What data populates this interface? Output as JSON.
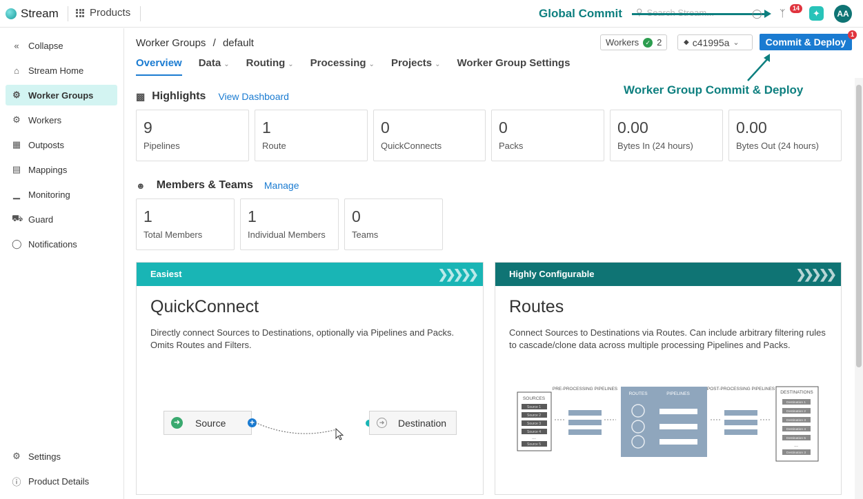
{
  "topbar": {
    "app_name": "Stream",
    "products_label": "Products",
    "global_commit_annotation": "Global Commit",
    "search_placeholder": "Search Stream...",
    "changes_badge": "14"
  },
  "user": {
    "initials": "AA"
  },
  "sidebar": {
    "items": [
      {
        "label": "Collapse"
      },
      {
        "label": "Stream Home"
      },
      {
        "label": "Worker Groups"
      },
      {
        "label": "Workers"
      },
      {
        "label": "Outposts"
      },
      {
        "label": "Mappings"
      },
      {
        "label": "Monitoring"
      },
      {
        "label": "Guard"
      },
      {
        "label": "Notifications"
      }
    ],
    "bottom_items": [
      {
        "label": "Settings"
      },
      {
        "label": "Product Details"
      }
    ]
  },
  "header": {
    "breadcrumb_parent": "Worker Groups",
    "breadcrumb_sep": "/",
    "breadcrumb_current": "default",
    "workers_label": "Workers",
    "workers_count": "2",
    "commit_hash": "c41995a",
    "deploy_label": "Commit & Deploy",
    "deploy_badge": "1",
    "wg_commit_annotation": "Worker Group Commit & Deploy"
  },
  "tabs": [
    {
      "label": "Overview"
    },
    {
      "label": "Data"
    },
    {
      "label": "Routing"
    },
    {
      "label": "Processing"
    },
    {
      "label": "Projects"
    },
    {
      "label": "Worker Group Settings"
    }
  ],
  "highlights": {
    "title": "Highlights",
    "link": "View Dashboard",
    "stats": [
      {
        "value": "9",
        "label": "Pipelines"
      },
      {
        "value": "1",
        "label": "Route"
      },
      {
        "value": "0",
        "label": "QuickConnects"
      },
      {
        "value": "0",
        "label": "Packs"
      },
      {
        "value": "0.00",
        "label": "Bytes In (24 hours)"
      },
      {
        "value": "0.00",
        "label": "Bytes Out (24 hours)"
      }
    ]
  },
  "members": {
    "title": "Members & Teams",
    "link": "Manage",
    "stats": [
      {
        "value": "1",
        "label": "Total Members"
      },
      {
        "value": "1",
        "label": "Individual Members"
      },
      {
        "value": "0",
        "label": "Teams"
      }
    ]
  },
  "quickconnect": {
    "tag": "Easiest",
    "title": "QuickConnect",
    "description": "Directly connect Sources to Destinations, optionally via Pipelines and Packs. Omits Routes and Filters.",
    "source_label": "Source",
    "destination_label": "Destination"
  },
  "routes": {
    "tag": "Highly Configurable",
    "title": "Routes",
    "description": "Connect Sources to Destinations via Routes. Can include arbitrary filtering rules to cascade/clone data across multiple processing Pipelines and Packs.",
    "diagram": {
      "sources_label": "SOURCES",
      "sources": [
        "Source 1",
        "Source 2",
        "Source 3",
        "Source 4",
        "...",
        "Source 5"
      ],
      "pre_label": "PRE-PROCESSING PIPELINES",
      "routes_label": "ROUTES",
      "pipelines_label": "PIPELINES",
      "post_label": "POST-PROCESSING PIPELINES",
      "destinations_label": "DESTINATIONS",
      "destinations": [
        "Destination 1",
        "Destination 2",
        "Destination 3",
        "Destination 4",
        "Destination 5",
        "...",
        "Destination 3"
      ]
    }
  },
  "colors": {
    "accent_blue": "#1a7bd1",
    "teal_light": "#19b5b5",
    "teal_dark": "#0f7474",
    "annotation": "#0d7f7f"
  }
}
